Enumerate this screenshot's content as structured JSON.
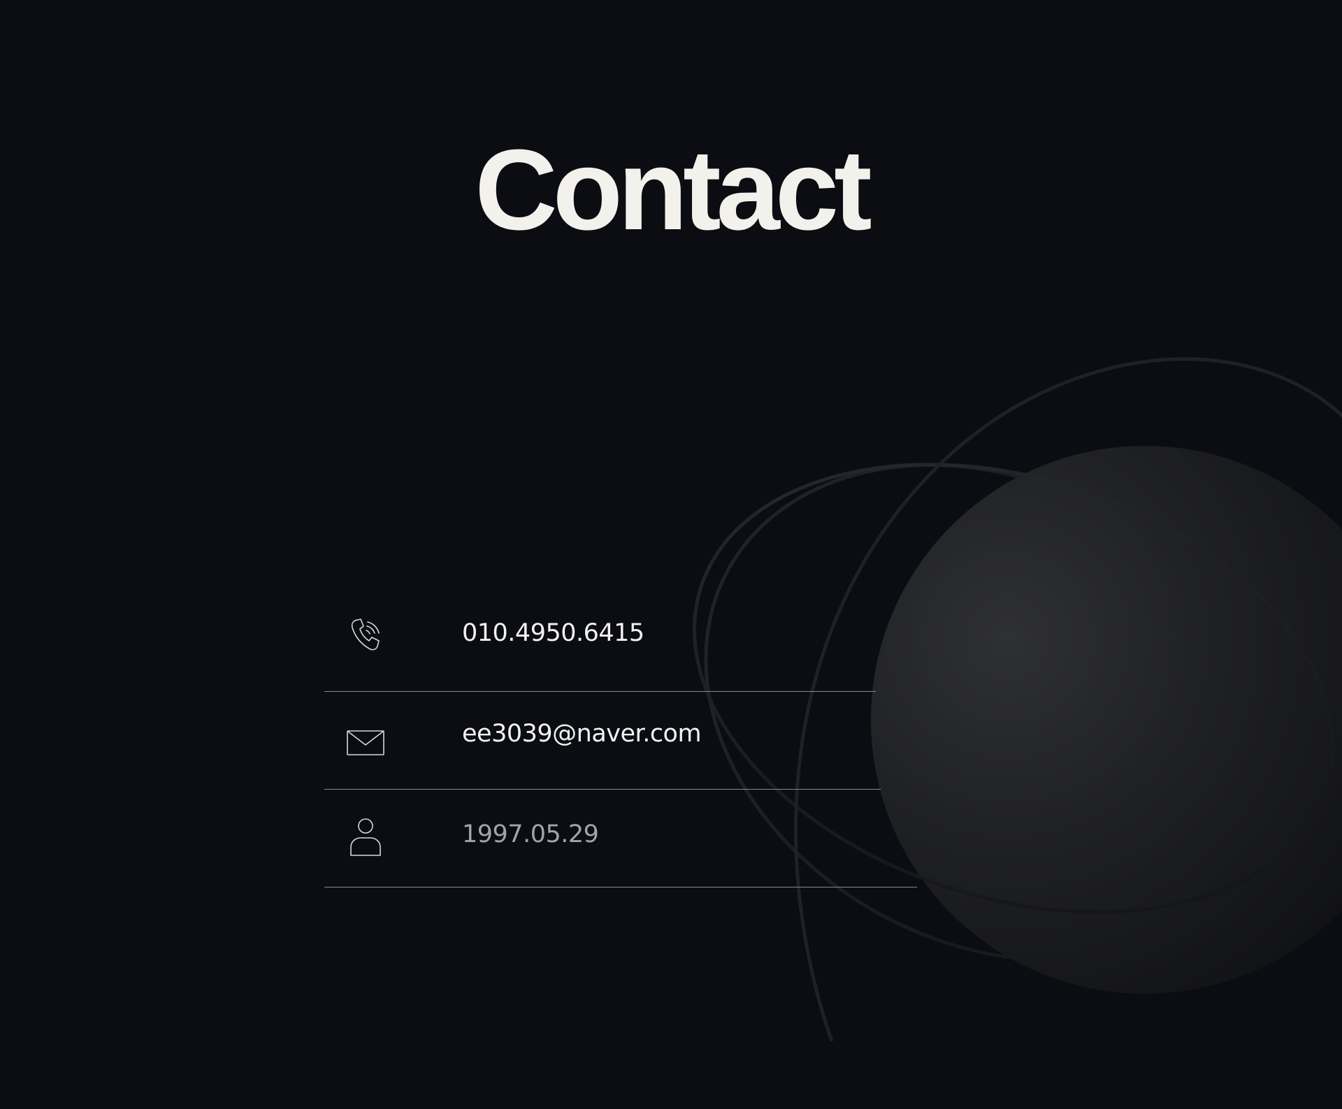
{
  "page": {
    "title": "Contact",
    "background_color": "#0b0d12",
    "title_color": "#f3f1ec",
    "line_color": "#8a8b8e"
  },
  "contact": {
    "items": [
      {
        "icon": "phone-icon",
        "value": "010.4950.6415",
        "color": "#f2f2f2"
      },
      {
        "icon": "mail-icon",
        "value": "ee3039@naver.com",
        "color": "#f2f2f2"
      },
      {
        "icon": "person-icon",
        "value": "1997.05.29",
        "color": "#a3a4a6"
      }
    ]
  }
}
